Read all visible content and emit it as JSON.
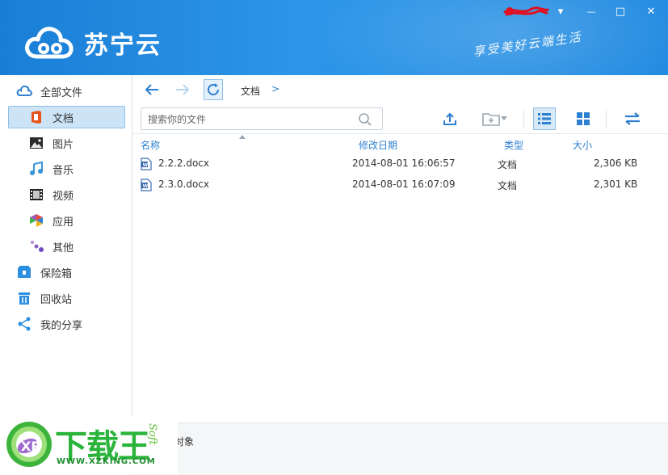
{
  "app": {
    "title": "苏宁云",
    "slogan": "享受美好云端生活"
  },
  "window_controls": {
    "menu": "▾",
    "minimize": "—",
    "maximize": "□",
    "close": "✕"
  },
  "sidebar": {
    "items": [
      {
        "label": "全部文件",
        "icon": "cloud-icon"
      },
      {
        "label": "文档",
        "icon": "office-doc-icon",
        "selected": true
      },
      {
        "label": "图片",
        "icon": "picture-icon"
      },
      {
        "label": "音乐",
        "icon": "music-note-icon"
      },
      {
        "label": "视频",
        "icon": "film-icon"
      },
      {
        "label": "应用",
        "icon": "app-icon"
      },
      {
        "label": "其他",
        "icon": "dots-icon"
      },
      {
        "label": "保险箱",
        "icon": "safe-icon"
      },
      {
        "label": "回收站",
        "icon": "trash-icon"
      },
      {
        "label": "我的分享",
        "icon": "share-icon"
      }
    ]
  },
  "nav": {
    "breadcrumb": "文档",
    "separator": ">"
  },
  "toolbar": {
    "search_placeholder": "搜索你的文件"
  },
  "table": {
    "columns": {
      "name": "名称",
      "modified": "修改日期",
      "type": "类型",
      "size": "大小"
    },
    "rows": [
      {
        "name": "2.2.2.docx",
        "modified": "2014-08-01 16:06:57",
        "type": "文档",
        "size": "2,306 KB"
      },
      {
        "name": "2.3.0.docx",
        "modified": "2014-08-01 16:07:09",
        "type": "文档",
        "size": "2,301 KB"
      }
    ]
  },
  "status": {
    "text": "对象"
  },
  "watermark": {
    "brand": "下载王",
    "url": "WWW.XZKING.COM",
    "soft": "Soft"
  },
  "colors": {
    "header_blue": "#2089e0",
    "accent": "#2d7fd0",
    "selection": "#cde4f7"
  }
}
